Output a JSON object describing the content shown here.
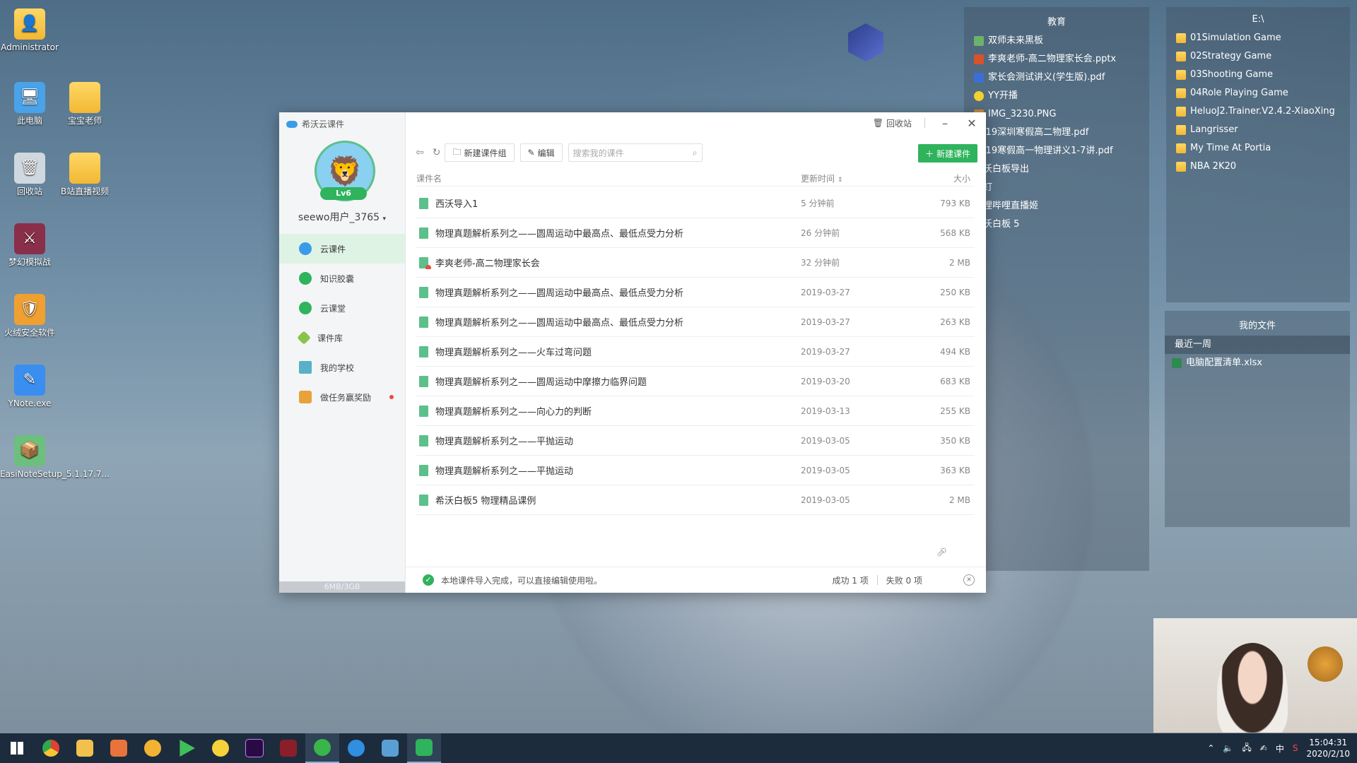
{
  "desktop_icons": [
    {
      "label": "Administrator",
      "icon": "user-folder-icon"
    },
    {
      "label": "此电脑",
      "icon": "computer-icon"
    },
    {
      "label": "宝宝老师",
      "icon": "folder-icon"
    },
    {
      "label": "回收站",
      "icon": "recycle-bin-icon"
    },
    {
      "label": "B站直播视频",
      "icon": "folder-icon"
    },
    {
      "label": "梦幻模拟战",
      "icon": "game-icon"
    },
    {
      "label": "火绒安全软件",
      "icon": "shield-icon"
    },
    {
      "label": "YNote.exe",
      "icon": "note-icon"
    },
    {
      "label": "EasiNoteSetup_5.1.17.7...",
      "icon": "installer-icon"
    }
  ],
  "fence_edu": {
    "title": "教育",
    "items": [
      "双师未来黑板",
      "李爽老师-高二物理家长会.pptx",
      "家长会测试讲义(学生版).pdf",
      "YY开播",
      "IMG_3230.PNG",
      "2019深圳寒假高二物理.pdf",
      "2019寒假高一物理讲义1-7讲.pdf",
      "西沃白板导出",
      "钉钉",
      "哔哩哔哩直播姬",
      "希沃白板 5"
    ]
  },
  "fence_e": {
    "title": "E:\\",
    "items": [
      "01Simulation Game",
      "02Strategy Game",
      "03Shooting Game",
      "04Role Playing Game",
      "HeluoJ2.Trainer.V2.4.2-XiaoXing",
      "Langrisser",
      "My Time At Portia",
      "NBA 2K20"
    ]
  },
  "fence_myfiles": {
    "title": "我的文件",
    "section": "最近一周",
    "items": [
      "电脑配置清单.xlsx"
    ]
  },
  "app": {
    "title": "希沃云课件",
    "recycle_label": "回收站",
    "user": {
      "name": "seewo用户_3765",
      "level": "Lv6"
    },
    "nav": [
      {
        "label": "云课件",
        "color": "#3a9ce8",
        "active": true
      },
      {
        "label": "知识胶囊",
        "color": "#2fb35d",
        "active": false
      },
      {
        "label": "云课堂",
        "color": "#2fb35d",
        "active": false
      },
      {
        "label": "课件库",
        "color": "#8ac34a",
        "active": false
      },
      {
        "label": "我的学校",
        "color": "#5ab0c8",
        "active": false
      },
      {
        "label": "做任务赢奖励",
        "color": "#e8a23a",
        "active": false
      }
    ],
    "quota": "6MB/3GB",
    "toolbar": {
      "new_group": "新建课件组",
      "edit": "编辑",
      "search_placeholder": "搜索我的课件",
      "new_courseware": "新建课件"
    },
    "columns": {
      "name": "课件名",
      "time": "更新时间",
      "size": "大小"
    },
    "files": [
      {
        "name": "西沃导入1",
        "time": "5 分钟前",
        "size": "793 KB"
      },
      {
        "name": "物理真题解析系列之——圆周运动中最高点、最低点受力分析",
        "time": "26 分钟前",
        "size": "568 KB"
      },
      {
        "name": "李爽老师-高二物理家长会",
        "time": "32 分钟前",
        "size": "2 MB"
      },
      {
        "name": "物理真题解析系列之——圆周运动中最高点、最低点受力分析",
        "time": "2019-03-27",
        "size": "250 KB"
      },
      {
        "name": "物理真题解析系列之——圆周运动中最高点、最低点受力分析",
        "time": "2019-03-27",
        "size": "263 KB"
      },
      {
        "name": "物理真题解析系列之——火车过弯问题",
        "time": "2019-03-27",
        "size": "494 KB"
      },
      {
        "name": "物理真题解析系列之——圆周运动中摩擦力临界问题",
        "time": "2019-03-20",
        "size": "683 KB"
      },
      {
        "name": "物理真题解析系列之——向心力的判断",
        "time": "2019-03-13",
        "size": "255 KB"
      },
      {
        "name": "物理真题解析系列之——平抛运动",
        "time": "2019-03-05",
        "size": "350 KB"
      },
      {
        "name": "物理真题解析系列之——平抛运动",
        "time": "2019-03-05",
        "size": "363 KB"
      },
      {
        "name": "希沃白板5 物理精品课例",
        "time": "2019-03-05",
        "size": "2 MB"
      }
    ],
    "status": {
      "message": "本地课件导入完成，可以直接编辑使用啦。",
      "success": "成功 1 项",
      "fail": "失败 0 项"
    }
  },
  "tray": {
    "time": "15:04:31",
    "date": "2020/2/10",
    "ime": "中"
  }
}
